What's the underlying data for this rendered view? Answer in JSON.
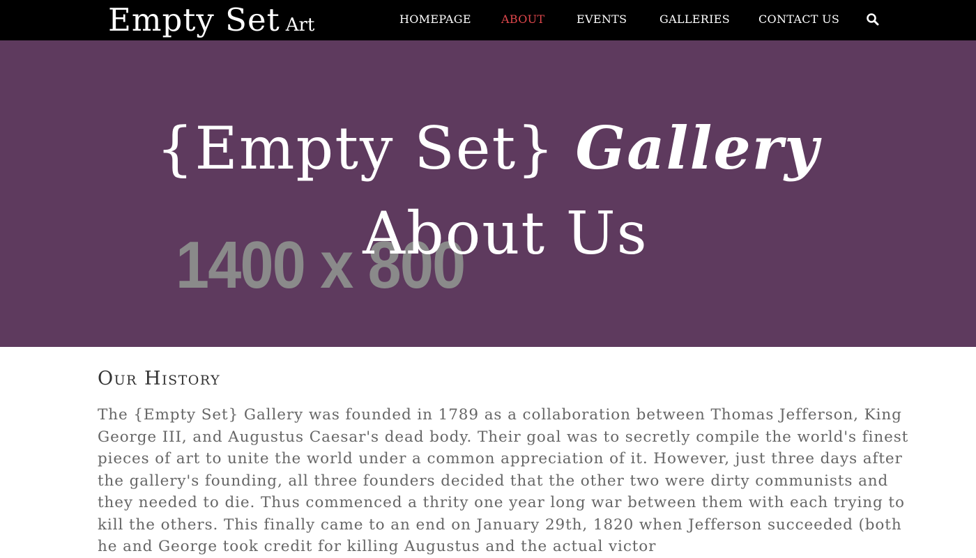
{
  "navbar": {
    "brand_main": "Empty Set",
    "brand_sub": "Art",
    "links": [
      {
        "label": "HOMEPAGE"
      },
      {
        "label": "ABOUT"
      },
      {
        "label": "EVENTS"
      },
      {
        "label": "GALLERIES"
      },
      {
        "label": "CONTACT US"
      }
    ],
    "active_link": "ABOUT",
    "search_icon": "search-icon"
  },
  "hero": {
    "placeholder_text": "1400 x 800",
    "title_part1": "{Empty Set}",
    "title_part2": "Gallery",
    "subtitle": "About Us"
  },
  "content": {
    "section_title": "Our History",
    "history_text": "The {Empty Set} Gallery was founded in 1789 as a collaboration between Thomas Jefferson, King George III, and Augustus Caesar's dead body. Their goal was to secretly compile the world's finest pieces of art to unite the world under a common appreciation of it. However, just three days after the gallery's founding, all three founders decided that the other two were dirty communists and they needed to die. Thus commenced a thrity one year long war between them with each trying to kill the others. This finally came to an end on January 29th, 1820 when Jefferson succeeded (both he and George took credit for killing Augustus and the actual victor"
  },
  "colors": {
    "navbar_bg": "#000000",
    "hero_bg": "#5e3a5e",
    "active_link": "#e0474c",
    "placeholder_text": "#8a8a8a",
    "body_text": "#666666"
  }
}
